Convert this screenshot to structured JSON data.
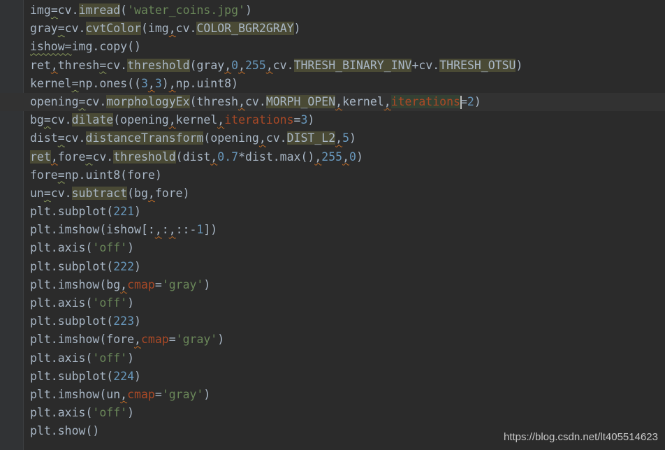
{
  "editor": {
    "current_line_index": 5,
    "colors": {
      "background": "#2b2b2b",
      "text": "#a9b7c6",
      "number": "#6897bb",
      "string": "#6a8759",
      "keyword_arg": "#aa4926",
      "highlight": "#4a4a35"
    },
    "lines": [
      [
        [
          "img",
          "p"
        ],
        [
          "=",
          "w"
        ],
        [
          "cv.",
          "p"
        ],
        [
          "imread",
          "h"
        ],
        [
          "(",
          "p"
        ],
        [
          "'water_coins.jpg'",
          "s"
        ],
        [
          ")",
          "p"
        ]
      ],
      [
        [
          "gray",
          "p"
        ],
        [
          "=",
          "w"
        ],
        [
          "cv.",
          "p"
        ],
        [
          "cvtColor",
          "h"
        ],
        [
          "(img",
          "p"
        ],
        [
          ",",
          "c"
        ],
        [
          "cv.",
          "p"
        ],
        [
          "COLOR_BGR2GRAY",
          "h"
        ],
        [
          ")",
          "p"
        ]
      ],
      [
        [
          "ishow=",
          "w"
        ],
        [
          "img.copy()",
          "p"
        ]
      ],
      [
        [
          "ret",
          "p"
        ],
        [
          ",",
          "c"
        ],
        [
          "thresh",
          "p"
        ],
        [
          "=",
          "w"
        ],
        [
          "cv.",
          "p"
        ],
        [
          "threshold",
          "h"
        ],
        [
          "(gray",
          "p"
        ],
        [
          ",",
          "c"
        ],
        [
          "0",
          "n"
        ],
        [
          ",",
          "c"
        ],
        [
          "255",
          "n"
        ],
        [
          ",",
          "c"
        ],
        [
          "cv.",
          "p"
        ],
        [
          "THRESH_BINARY_INV",
          "h"
        ],
        [
          "+cv.",
          "p"
        ],
        [
          "THRESH_OTSU",
          "h"
        ],
        [
          ")",
          "p"
        ]
      ],
      [
        [
          "kernel",
          "p"
        ],
        [
          "=",
          "w"
        ],
        [
          "np.ones((",
          "p"
        ],
        [
          "3",
          "n"
        ],
        [
          ",",
          "c"
        ],
        [
          "3",
          "n"
        ],
        [
          ")",
          "p"
        ],
        [
          ",",
          "c"
        ],
        [
          "np.uint8)",
          "p"
        ]
      ],
      [
        [
          "opening",
          "p"
        ],
        [
          "=",
          "w"
        ],
        [
          "cv.",
          "p"
        ],
        [
          "morphologyEx",
          "h"
        ],
        [
          "(thresh",
          "p"
        ],
        [
          ",",
          "c"
        ],
        [
          "cv.",
          "p"
        ],
        [
          "MORPH_OPEN",
          "h"
        ],
        [
          ",",
          "c"
        ],
        [
          "kernel",
          "p"
        ],
        [
          ",",
          "c"
        ],
        [
          "iterations",
          "hk"
        ],
        [
          "|",
          "caret"
        ],
        [
          "=",
          "p"
        ],
        [
          "2",
          "n"
        ],
        [
          ")",
          "p"
        ]
      ],
      [
        [
          "bg",
          "p"
        ],
        [
          "=",
          "w"
        ],
        [
          "cv.",
          "p"
        ],
        [
          "dilate",
          "h"
        ],
        [
          "(opening",
          "p"
        ],
        [
          ",",
          "c"
        ],
        [
          "kernel",
          "p"
        ],
        [
          ",",
          "c"
        ],
        [
          "iterations",
          "k"
        ],
        [
          "=",
          "p"
        ],
        [
          "3",
          "n"
        ],
        [
          ")",
          "p"
        ]
      ],
      [
        [
          "dist",
          "p"
        ],
        [
          "=",
          "w"
        ],
        [
          "cv.",
          "p"
        ],
        [
          "distanceTransform",
          "h"
        ],
        [
          "(opening",
          "p"
        ],
        [
          ",",
          "c"
        ],
        [
          "cv.",
          "p"
        ],
        [
          "DIST_L2",
          "h"
        ],
        [
          ",",
          "c"
        ],
        [
          "5",
          "n"
        ],
        [
          ")",
          "p"
        ]
      ],
      [
        [
          "ret",
          "h"
        ],
        [
          ",",
          "c"
        ],
        [
          "fore",
          "p"
        ],
        [
          "=",
          "w"
        ],
        [
          "cv.",
          "p"
        ],
        [
          "threshold",
          "h"
        ],
        [
          "(dist",
          "p"
        ],
        [
          ",",
          "c"
        ],
        [
          "0.7",
          "n"
        ],
        [
          "*dist.max()",
          "p"
        ],
        [
          ",",
          "c"
        ],
        [
          "255",
          "n"
        ],
        [
          ",",
          "c"
        ],
        [
          "0",
          "n"
        ],
        [
          ")",
          "p"
        ]
      ],
      [
        [
          "fore",
          "p"
        ],
        [
          "=",
          "w"
        ],
        [
          "np.uint8(fore)",
          "p"
        ]
      ],
      [
        [
          "un",
          "p"
        ],
        [
          "=",
          "w"
        ],
        [
          "cv.",
          "p"
        ],
        [
          "subtract",
          "h"
        ],
        [
          "(bg",
          "p"
        ],
        [
          ",",
          "c"
        ],
        [
          "fore)",
          "p"
        ]
      ],
      [
        [
          "plt.subplot(",
          "p"
        ],
        [
          "221",
          "n"
        ],
        [
          ")",
          "p"
        ]
      ],
      [
        [
          "plt.imshow(ishow[:",
          "p"
        ],
        [
          ",",
          "c"
        ],
        [
          ":",
          "p"
        ],
        [
          ",",
          "c"
        ],
        [
          "::-",
          "p"
        ],
        [
          "1",
          "n"
        ],
        [
          "])",
          "p"
        ]
      ],
      [
        [
          "plt.axis(",
          "p"
        ],
        [
          "'off'",
          "s"
        ],
        [
          ")",
          "p"
        ]
      ],
      [
        [
          "plt.subplot(",
          "p"
        ],
        [
          "222",
          "n"
        ],
        [
          ")",
          "p"
        ]
      ],
      [
        [
          "plt.imshow(bg",
          "p"
        ],
        [
          ",",
          "c"
        ],
        [
          "cmap",
          "k"
        ],
        [
          "=",
          "p"
        ],
        [
          "'gray'",
          "s"
        ],
        [
          ")",
          "p"
        ]
      ],
      [
        [
          "plt.axis(",
          "p"
        ],
        [
          "'off'",
          "s"
        ],
        [
          ")",
          "p"
        ]
      ],
      [
        [
          "plt.subplot(",
          "p"
        ],
        [
          "223",
          "n"
        ],
        [
          ")",
          "p"
        ]
      ],
      [
        [
          "plt.imshow(fore",
          "p"
        ],
        [
          ",",
          "c"
        ],
        [
          "cmap",
          "k"
        ],
        [
          "=",
          "p"
        ],
        [
          "'gray'",
          "s"
        ],
        [
          ")",
          "p"
        ]
      ],
      [
        [
          "plt.axis(",
          "p"
        ],
        [
          "'off'",
          "s"
        ],
        [
          ")",
          "p"
        ]
      ],
      [
        [
          "plt.subplot(",
          "p"
        ],
        [
          "224",
          "n"
        ],
        [
          ")",
          "p"
        ]
      ],
      [
        [
          "plt.imshow(un",
          "p"
        ],
        [
          ",",
          "c"
        ],
        [
          "cmap",
          "k"
        ],
        [
          "=",
          "p"
        ],
        [
          "'gray'",
          "s"
        ],
        [
          ")",
          "p"
        ]
      ],
      [
        [
          "plt.axis(",
          "p"
        ],
        [
          "'off'",
          "s"
        ],
        [
          ")",
          "p"
        ]
      ],
      [
        [
          "plt.show()",
          "p"
        ]
      ]
    ]
  },
  "watermark": "https://blog.csdn.net/lt405514623"
}
